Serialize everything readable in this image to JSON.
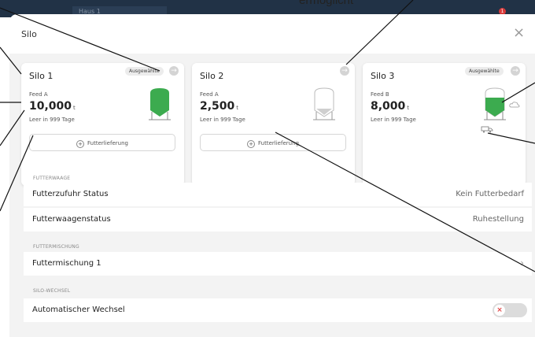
{
  "background": {
    "tab_label": "Haus 1",
    "notification_count": "1",
    "callout_text": "ermöglicht"
  },
  "modal": {
    "title": "Silo",
    "close_symbol": "×"
  },
  "silos": [
    {
      "name": "Silo 1",
      "badge": "Ausgewählte",
      "feed": "Feed A",
      "amount": "10,000",
      "unit": "t",
      "empty_in": "Leer in 999 Tage",
      "delivery_label": "Futterlieferung",
      "fill_level": 0.85
    },
    {
      "name": "Silo 2",
      "badge": "",
      "feed": "Feed A",
      "amount": "2,500",
      "unit": "t",
      "empty_in": "Leer in 999 Tage",
      "delivery_label": "Futterlieferung",
      "fill_level": 0.2
    },
    {
      "name": "Silo 3",
      "badge": "Ausgewählte",
      "feed": "Feed B",
      "amount": "8,000",
      "unit": "t",
      "empty_in": "Leer in 999 Tage",
      "delivery_label": "",
      "fill_level": 0.7
    }
  ],
  "futterwaage": {
    "section_label": "FUTTERWAAGE",
    "rows": [
      {
        "label": "Futterzufuhr Status",
        "value": "Kein Futterbedarf"
      },
      {
        "label": "Futterwaagenstatus",
        "value": "Ruhestellung"
      }
    ]
  },
  "futtermischung": {
    "section_label": "FUTTERMISCHUNG",
    "item": "Futtermischung 1"
  },
  "silo_wechsel": {
    "section_label": "SILO-WECHSEL",
    "label": "Automatischer Wechsel",
    "enabled": false
  },
  "colors": {
    "silo_green": "#3cab4f",
    "dark_header": "#213246",
    "toggle_off_icon": "#e04343"
  },
  "icons": [
    "arrow-right-icon",
    "plus-circle-icon",
    "silo-icon",
    "truck-icon",
    "close-icon",
    "chevron-right-icon",
    "toggle-x-icon"
  ]
}
